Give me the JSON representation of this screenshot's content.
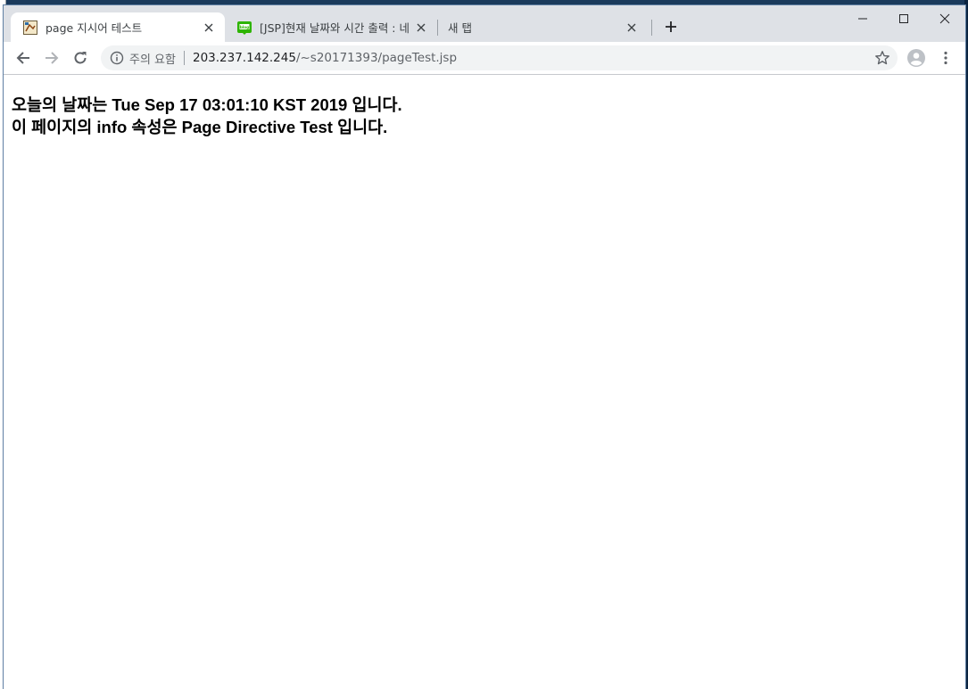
{
  "browser": {
    "tabs": [
      {
        "title": "page 지시어 테스트",
        "active": true
      },
      {
        "title": "[JSP]현재 날짜와 시간 출력 : 네이",
        "active": false
      },
      {
        "title": "새 탭",
        "active": false
      }
    ],
    "omnibox": {
      "security_label": "주의 요함",
      "url_host": "203.237.142.245",
      "url_path": "/~s20171393/pageTest.jsp"
    }
  },
  "page": {
    "line1": "오늘의 날짜는 Tue Sep 17 03:01:10 KST 2019 입니다.",
    "line2": "이 페이지의 info 속성은 Page Directive Test 입니다."
  },
  "colors": {
    "tabstrip": "#dee1e6",
    "omnibox": "#f1f3f4",
    "blog_icon_green": "#2db400"
  },
  "icons": [
    "page-favicon",
    "blog-favicon",
    "close-icon",
    "plus-icon",
    "minimize-icon",
    "maximize-icon",
    "window-close-icon",
    "back-arrow-icon",
    "forward-arrow-icon",
    "reload-icon",
    "info-icon",
    "star-icon",
    "profile-avatar-icon",
    "kebab-menu-icon"
  ]
}
